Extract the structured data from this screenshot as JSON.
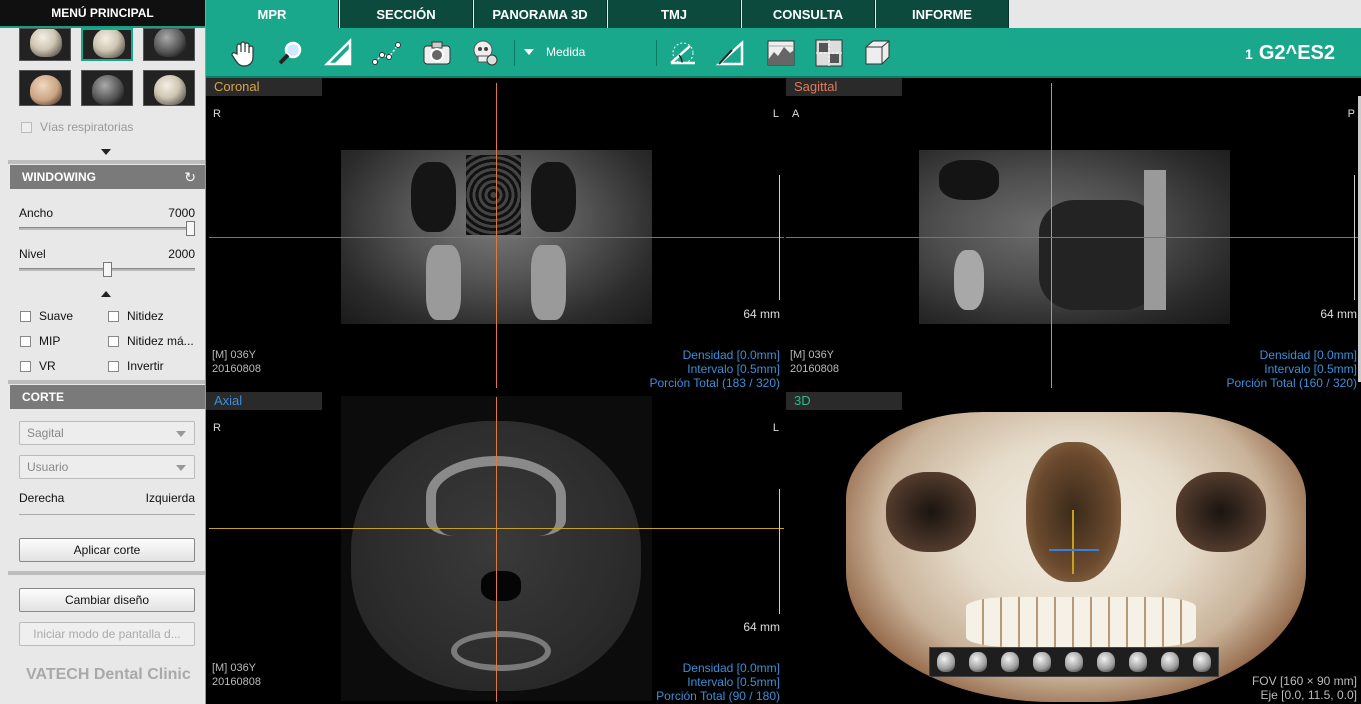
{
  "sidebar": {
    "title": "MENÚ PRINCIPAL",
    "airway_label": "Vías respiratorias",
    "windowing": {
      "title": "WINDOWING",
      "width_label": "Ancho",
      "width_value": "7000",
      "width_level": 1.0,
      "level_label": "Nivel",
      "level_value": "2000",
      "level_level": 0.5
    },
    "filters": [
      {
        "label": "Suave",
        "checked": false
      },
      {
        "label": "Nitidez",
        "checked": false
      },
      {
        "label": "MIP",
        "checked": false
      },
      {
        "label": "Nitidez má...",
        "checked": false
      },
      {
        "label": "VR",
        "checked": false
      },
      {
        "label": "Invertir",
        "checked": false
      }
    ],
    "corte": {
      "title": "CORTE",
      "plane_select": "Sagital",
      "mode_select": "Usuario",
      "right_label": "Derecha",
      "left_label": "Izquierda",
      "apply_button": "Aplicar corte"
    },
    "change_layout_button": "Cambiar diseño",
    "fullscreen_button": "Iniciar modo de pantalla d...",
    "brand": "VATECH Dental Clinic"
  },
  "tabs": [
    "MPR",
    "SECCIÓN",
    "PANORAMA 3D",
    "TMJ",
    "CONSULTA",
    "INFORME"
  ],
  "active_tab": "MPR",
  "toolbar": {
    "measure_label": "Medida",
    "tool_icons": [
      "hand-icon",
      "magnifier-icon",
      "ruler-icon",
      "polyline-icon",
      "camera-icon",
      "skull-icon"
    ],
    "right_icons": [
      "angle-icon",
      "triangle-icon",
      "histogram-icon",
      "grid-icon",
      "cube-icon"
    ],
    "patient_index": "1",
    "patient_name": "G2^ES2"
  },
  "viewports": {
    "coronal": {
      "title": "Coronal",
      "left_dir": "R",
      "right_dir": "L",
      "scale": "64 mm",
      "info_l1": "[M] 036Y",
      "info_l2": "20160808",
      "info_r1": "Densidad [0.0mm]",
      "info_r2": "Intervalo [0.5mm]",
      "info_r3": "Porción Total (183 / 320)"
    },
    "sagittal": {
      "title": "Sagittal",
      "left_dir": "A",
      "right_dir": "P",
      "scale": "64 mm",
      "info_l1": "[M] 036Y",
      "info_l2": "20160808",
      "info_r1": "Densidad [0.0mm]",
      "info_r2": "Intervalo [0.5mm]",
      "info_r3": "Porción Total (160 / 320)"
    },
    "axial": {
      "title": "Axial",
      "left_dir": "R",
      "right_dir": "L",
      "scale": "64 mm",
      "info_l1": "[M] 036Y",
      "info_l2": "20160808",
      "info_r1": "Densidad [0.0mm]",
      "info_r2": "Intervalo [0.5mm]",
      "info_r3": "Porción Total (90 / 180)"
    },
    "volume3d": {
      "title": "3D",
      "fov": "FOV [160 × 90 mm]",
      "axis": "Eje [0.0, 11.5, 0.0]"
    }
  },
  "colors": {
    "accent": "#1aa88c",
    "tab_dark": "#0b4a3c",
    "coronal_title": "#d8a44a",
    "sagittal_title": "#e07a5a",
    "axial_title": "#3b8fd8",
    "v3d_title": "#2fb88a",
    "crosshair_orange": "#e07a3a",
    "crosshair_blue": "#3b7fd8",
    "crosshair_yellow": "#c8a020",
    "info_blue": "#3b8fd8"
  }
}
